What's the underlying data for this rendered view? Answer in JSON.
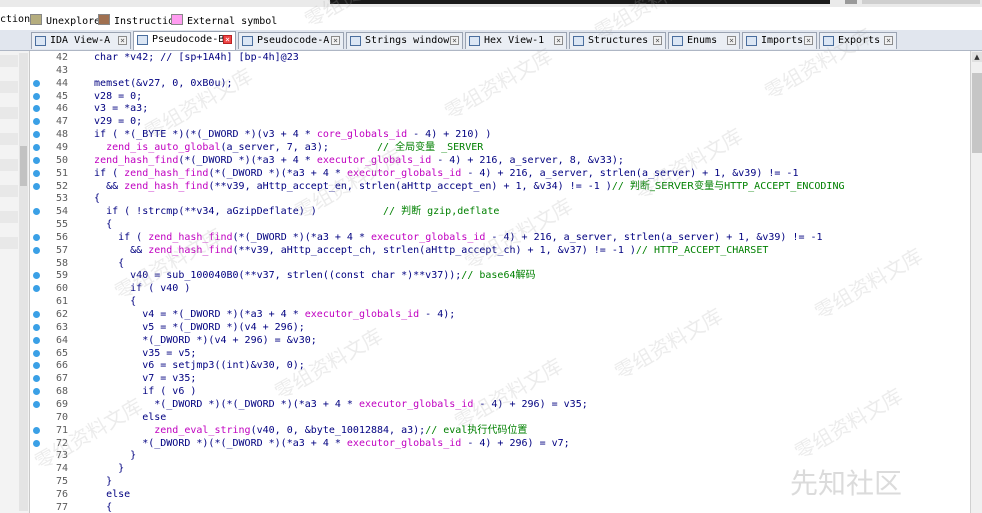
{
  "legend": [
    {
      "label": "ction",
      "color": ""
    },
    {
      "label": "Unexplored",
      "color": "#b5ad7e"
    },
    {
      "label": "Instruction",
      "color": "#a07050"
    },
    {
      "label": "External symbol",
      "color": "#ff9cf0"
    }
  ],
  "left_tab_fragment": "x",
  "tabs": [
    {
      "label": "IDA View-A",
      "icon": "ida-view-icon",
      "active": false
    },
    {
      "label": "Pseudocode-B",
      "icon": "pseudocode-icon",
      "active": true
    },
    {
      "label": "Pseudocode-A",
      "icon": "pseudocode-icon",
      "active": false
    },
    {
      "label": "Strings window",
      "icon": "strings-icon",
      "active": false
    },
    {
      "label": "Hex View-1",
      "icon": "hex-view-icon",
      "active": false
    },
    {
      "label": "Structures",
      "icon": "structures-icon",
      "active": false
    },
    {
      "label": "Enums",
      "icon": "enums-icon",
      "active": false
    },
    {
      "label": "Imports",
      "icon": "imports-icon",
      "active": false
    },
    {
      "label": "Exports",
      "icon": "exports-icon",
      "active": false
    }
  ],
  "code_lines": [
    {
      "n": "42",
      "dot": false,
      "segs": [
        [
          "t",
          "  char *v42; // [sp+1A4h] [bp-4h]@23"
        ]
      ]
    },
    {
      "n": "43",
      "dot": false,
      "segs": [
        [
          "t",
          ""
        ]
      ]
    },
    {
      "n": "44",
      "dot": true,
      "segs": [
        [
          "t",
          "  memset(&v27, 0, 0xB0u);"
        ]
      ]
    },
    {
      "n": "45",
      "dot": true,
      "segs": [
        [
          "t",
          "  v28 = 0;"
        ]
      ]
    },
    {
      "n": "46",
      "dot": true,
      "segs": [
        [
          "t",
          "  v3 = *a3;"
        ]
      ]
    },
    {
      "n": "47",
      "dot": true,
      "segs": [
        [
          "t",
          "  v29 = 0;"
        ]
      ]
    },
    {
      "n": "48",
      "dot": true,
      "segs": [
        [
          "t",
          "  if ( *(_BYTE *)(*(_DWORD *)(v3 + 4 * "
        ],
        [
          "f",
          "core_globals_id"
        ],
        [
          "t",
          " - 4) + 210) )"
        ]
      ]
    },
    {
      "n": "49",
      "dot": true,
      "segs": [
        [
          "t",
          "    "
        ],
        [
          "f",
          "zend_is_auto_global"
        ],
        [
          "t",
          "(a_server, 7, a3);        "
        ],
        [
          "c",
          "// "
        ],
        [
          "z",
          "全局变量"
        ],
        [
          "c",
          " _SERVER"
        ]
      ]
    },
    {
      "n": "50",
      "dot": true,
      "segs": [
        [
          "t",
          "  "
        ],
        [
          "f",
          "zend_hash_find"
        ],
        [
          "t",
          "(*(_DWORD *)(*a3 + 4 * "
        ],
        [
          "f",
          "executor_globals_id"
        ],
        [
          "t",
          " - 4) + 216, a_server, 8, &v33);"
        ]
      ]
    },
    {
      "n": "51",
      "dot": true,
      "segs": [
        [
          "t",
          "  if ( "
        ],
        [
          "f",
          "zend_hash_find"
        ],
        [
          "t",
          "(*(_DWORD *)(*a3 + 4 * "
        ],
        [
          "f",
          "executor_globals_id"
        ],
        [
          "t",
          " - 4) + 216, a_server, strlen(a_server) + 1, &v39) != -1"
        ]
      ]
    },
    {
      "n": "52",
      "dot": true,
      "segs": [
        [
          "t",
          "    && "
        ],
        [
          "f",
          "zend_hash_find"
        ],
        [
          "t",
          "(**v39, aHttp_accept_en, strlen(aHttp_accept_en) + 1, &v34) != -1 )"
        ],
        [
          "c",
          "// "
        ],
        [
          "z",
          "判断_SERVER变量与"
        ],
        [
          "c",
          "HTTP_ACCEPT_ENCODING"
        ]
      ]
    },
    {
      "n": "53",
      "dot": false,
      "segs": [
        [
          "t",
          "  {"
        ]
      ]
    },
    {
      "n": "54",
      "dot": true,
      "segs": [
        [
          "t",
          "    if ( !strcmp(**v34, aGzipDeflate) )           "
        ],
        [
          "c",
          "// "
        ],
        [
          "z",
          "判断"
        ],
        [
          "c",
          " gzip,deflate"
        ]
      ]
    },
    {
      "n": "55",
      "dot": false,
      "segs": [
        [
          "t",
          "    {"
        ]
      ]
    },
    {
      "n": "56",
      "dot": true,
      "segs": [
        [
          "t",
          "      if ( "
        ],
        [
          "f",
          "zend_hash_find"
        ],
        [
          "t",
          "(*(_DWORD *)(*a3 + 4 * "
        ],
        [
          "f",
          "executor_globals_id"
        ],
        [
          "t",
          " - 4) + 216, a_server, strlen(a_server) + 1, &v39) != -1"
        ]
      ]
    },
    {
      "n": "57",
      "dot": true,
      "segs": [
        [
          "t",
          "        && "
        ],
        [
          "f",
          "zend_hash_find"
        ],
        [
          "t",
          "(**v39, aHttp_accept_ch, strlen(aHttp_accept_ch) + 1, &v37) != -1 )"
        ],
        [
          "c",
          "// HTTP_ACCEPT_CHARSET"
        ]
      ]
    },
    {
      "n": "58",
      "dot": false,
      "segs": [
        [
          "t",
          "      {"
        ]
      ]
    },
    {
      "n": "59",
      "dot": true,
      "segs": [
        [
          "t",
          "        v40 = sub_100040B0(**v37, strlen((const char *)**v37));"
        ],
        [
          "c",
          "// base64"
        ],
        [
          "z",
          "解码"
        ]
      ]
    },
    {
      "n": "60",
      "dot": true,
      "segs": [
        [
          "t",
          "        if ( v40 )"
        ]
      ]
    },
    {
      "n": "61",
      "dot": false,
      "segs": [
        [
          "t",
          "        {"
        ]
      ]
    },
    {
      "n": "62",
      "dot": true,
      "segs": [
        [
          "t",
          "          v4 = *(_DWORD *)(*a3 + 4 * "
        ],
        [
          "f",
          "executor_globals_id"
        ],
        [
          "t",
          " - 4);"
        ]
      ]
    },
    {
      "n": "63",
      "dot": true,
      "segs": [
        [
          "t",
          "          v5 = *(_DWORD *)(v4 + 296);"
        ]
      ]
    },
    {
      "n": "64",
      "dot": true,
      "segs": [
        [
          "t",
          "          *(_DWORD *)(v4 + 296) = &v30;"
        ]
      ]
    },
    {
      "n": "65",
      "dot": true,
      "segs": [
        [
          "t",
          "          v35 = v5;"
        ]
      ]
    },
    {
      "n": "66",
      "dot": true,
      "segs": [
        [
          "t",
          "          v6 = setjmp3((int)&v30, 0);"
        ]
      ]
    },
    {
      "n": "67",
      "dot": true,
      "segs": [
        [
          "t",
          "          v7 = v35;"
        ]
      ]
    },
    {
      "n": "68",
      "dot": true,
      "segs": [
        [
          "t",
          "          if ( v6 )"
        ]
      ]
    },
    {
      "n": "69",
      "dot": true,
      "segs": [
        [
          "t",
          "            *(_DWORD *)(*(_DWORD *)(*a3 + 4 * "
        ],
        [
          "f",
          "executor_globals_id"
        ],
        [
          "t",
          " - 4) + 296) = v35;"
        ]
      ]
    },
    {
      "n": "70",
      "dot": false,
      "segs": [
        [
          "t",
          "          else"
        ]
      ]
    },
    {
      "n": "71",
      "dot": true,
      "segs": [
        [
          "t",
          "            "
        ],
        [
          "f",
          "zend_eval_string"
        ],
        [
          "t",
          "(v40, 0, &byte_10012884, a3);"
        ],
        [
          "c",
          "// eval"
        ],
        [
          "z",
          "执行代码位置"
        ]
      ]
    },
    {
      "n": "72",
      "dot": true,
      "segs": [
        [
          "t",
          "          *(_DWORD *)(*(_DWORD *)(*a3 + 4 * "
        ],
        [
          "f",
          "executor_globals_id"
        ],
        [
          "t",
          " - 4) + 296) = v7;"
        ]
      ]
    },
    {
      "n": "73",
      "dot": false,
      "segs": [
        [
          "t",
          "        }"
        ]
      ]
    },
    {
      "n": "74",
      "dot": false,
      "segs": [
        [
          "t",
          "      }"
        ]
      ]
    },
    {
      "n": "75",
      "dot": false,
      "segs": [
        [
          "t",
          "    }"
        ]
      ]
    },
    {
      "n": "76",
      "dot": false,
      "segs": [
        [
          "t",
          "    else"
        ]
      ]
    },
    {
      "n": "77",
      "dot": false,
      "segs": [
        [
          "t",
          "    {"
        ]
      ]
    }
  ],
  "watermark_text": "零组资料文库",
  "brand_text": "先知社区",
  "colors": {
    "breakpoint": "#3aa0e6",
    "keyword": "#000080",
    "function": "#c000c0",
    "comment": "#008000"
  }
}
